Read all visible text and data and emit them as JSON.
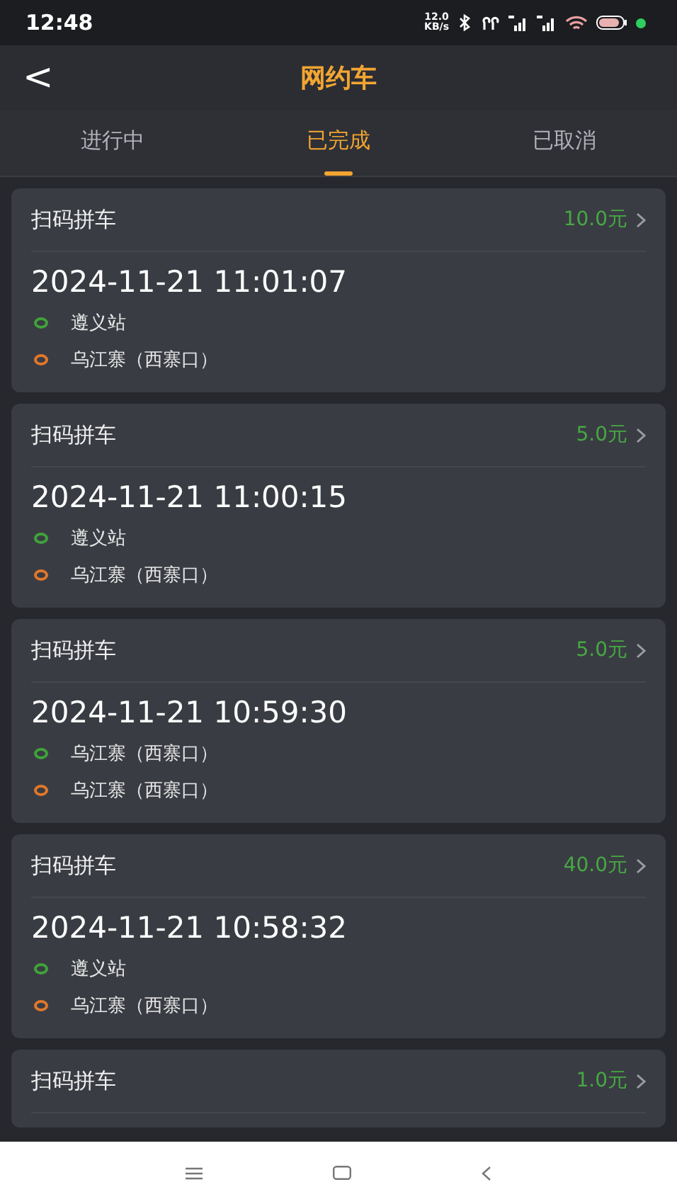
{
  "status_bar": {
    "time": "12:48",
    "net_speed": "12.0",
    "net_unit": "KB/s"
  },
  "header": {
    "back": "<",
    "title": "网约车"
  },
  "tabs": [
    {
      "label": "进行中",
      "selected": false
    },
    {
      "label": "已完成",
      "selected": true
    },
    {
      "label": "已取消",
      "selected": false
    }
  ],
  "orders": [
    {
      "type": "扫码拼车",
      "price": "10.0元",
      "time": "2024-11-21 11:01:07",
      "stops": [
        {
          "name": "遵义站",
          "color": "#3fa33a"
        },
        {
          "name": "乌江寨（西寨口）",
          "color": "#e0782a"
        }
      ]
    },
    {
      "type": "扫码拼车",
      "price": "5.0元",
      "time": "2024-11-21 11:00:15",
      "stops": [
        {
          "name": "遵义站",
          "color": "#3fa33a"
        },
        {
          "name": "乌江寨（西寨口）",
          "color": "#e0782a"
        }
      ]
    },
    {
      "type": "扫码拼车",
      "price": "5.0元",
      "time": "2024-11-21 10:59:30",
      "stops": [
        {
          "name": "乌江寨（西寨口）",
          "color": "#3fa33a"
        },
        {
          "name": "乌江寨（西寨口）",
          "color": "#e0782a"
        }
      ]
    },
    {
      "type": "扫码拼车",
      "price": "40.0元",
      "time": "2024-11-21 10:58:32",
      "stops": [
        {
          "name": "遵义站",
          "color": "#3fa33a"
        },
        {
          "name": "乌江寨（西寨口）",
          "color": "#e0782a"
        }
      ]
    },
    {
      "type": "扫码拼车",
      "price": "1.0元"
    }
  ]
}
